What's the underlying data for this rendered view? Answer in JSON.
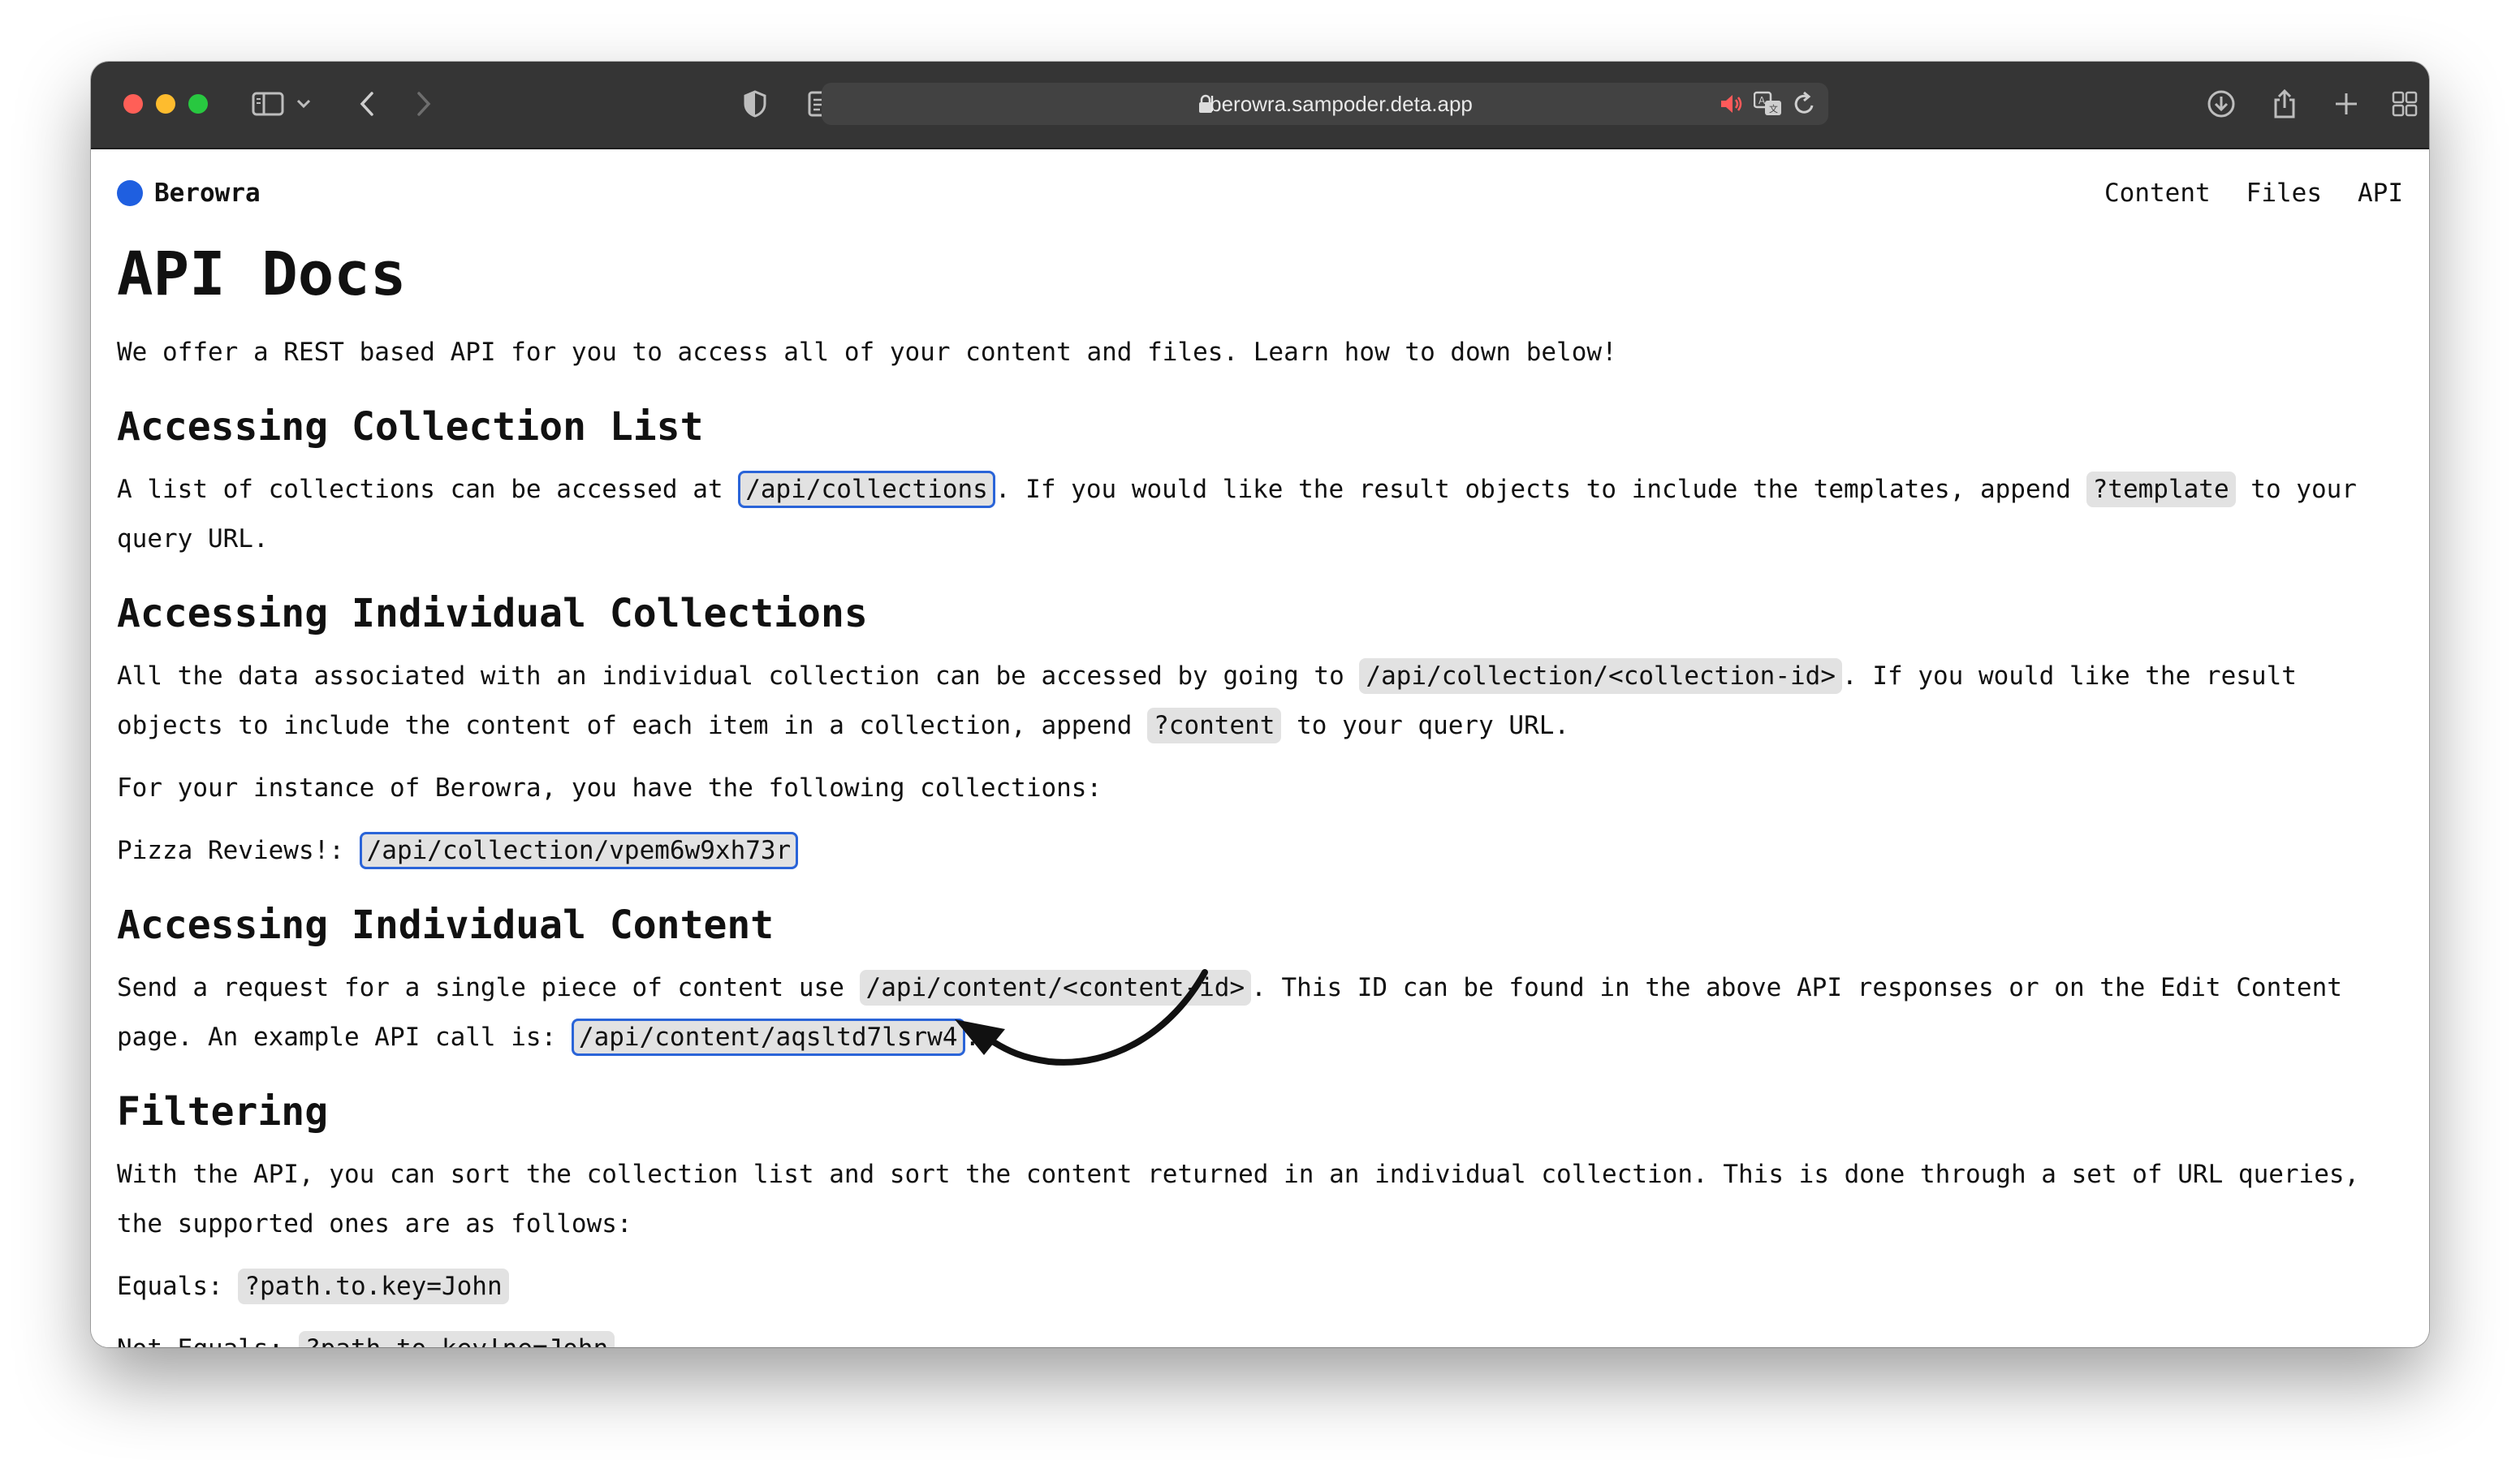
{
  "browser": {
    "url": "berowra.sampoder.deta.app",
    "icons": [
      "sidebar-icon",
      "chevron-down-icon",
      "back-icon",
      "forward-icon",
      "privacy-shield-icon",
      "reader-icon",
      "lock-icon",
      "speaker-muted-icon",
      "translate-icon",
      "reload-icon",
      "download-icon",
      "share-icon",
      "new-tab-icon",
      "tab-overview-icon"
    ]
  },
  "site": {
    "brand": "Berowra",
    "brand_color": "#1f5fe0",
    "nav": [
      "Content",
      "Files",
      "API"
    ]
  },
  "doc": {
    "title": "API Docs",
    "intro": "We offer a REST based API for you to access all of your content and files. Learn how to down below!",
    "collection_list": {
      "heading": "Accessing Collection List",
      "t1": "A list of collections can be accessed at",
      "code1": "/api/collections",
      "t2": ". If you would like the result objects to include the templates, append",
      "code2": "?template",
      "t3": "to your query URL."
    },
    "individual_collections": {
      "heading": "Accessing Individual Collections",
      "t1": "All the data associated with an individual collection can be accessed by going to",
      "code1": "/api/collection/<collection-id>",
      "t2": ". If you would like the result objects to include the content of each item in a collection, append",
      "code2": "?content",
      "t3": "to your query URL.",
      "instance_text": "For your instance of Berowra, you have the following collections:",
      "collection_label": "Pizza Reviews!:",
      "collection_code": "/api/collection/vpem6w9xh73r"
    },
    "individual_content": {
      "heading": "Accessing Individual Content",
      "t1": "Send a request for a single piece of content use",
      "code1": "/api/content/<content-id>",
      "t2": ". This ID can be found in the above API responses or on the Edit Content page. An example API call is:",
      "code2": "/api/content/aqsltd7lsrw4",
      "t3": "."
    },
    "filtering": {
      "heading": "Filtering",
      "text": "With the API, you can sort the collection list and sort the content returned in an individual collection. This is done through a set of URL queries, the supported ones are as follows:",
      "equals_label": "Equals:",
      "equals_code": "?path.to.key=John",
      "not_equals_label": "Not Equals:",
      "not_equals_code": "?path.to.key!ne=John"
    }
  },
  "annotation": {
    "icon": "arrow-annotation-icon"
  }
}
